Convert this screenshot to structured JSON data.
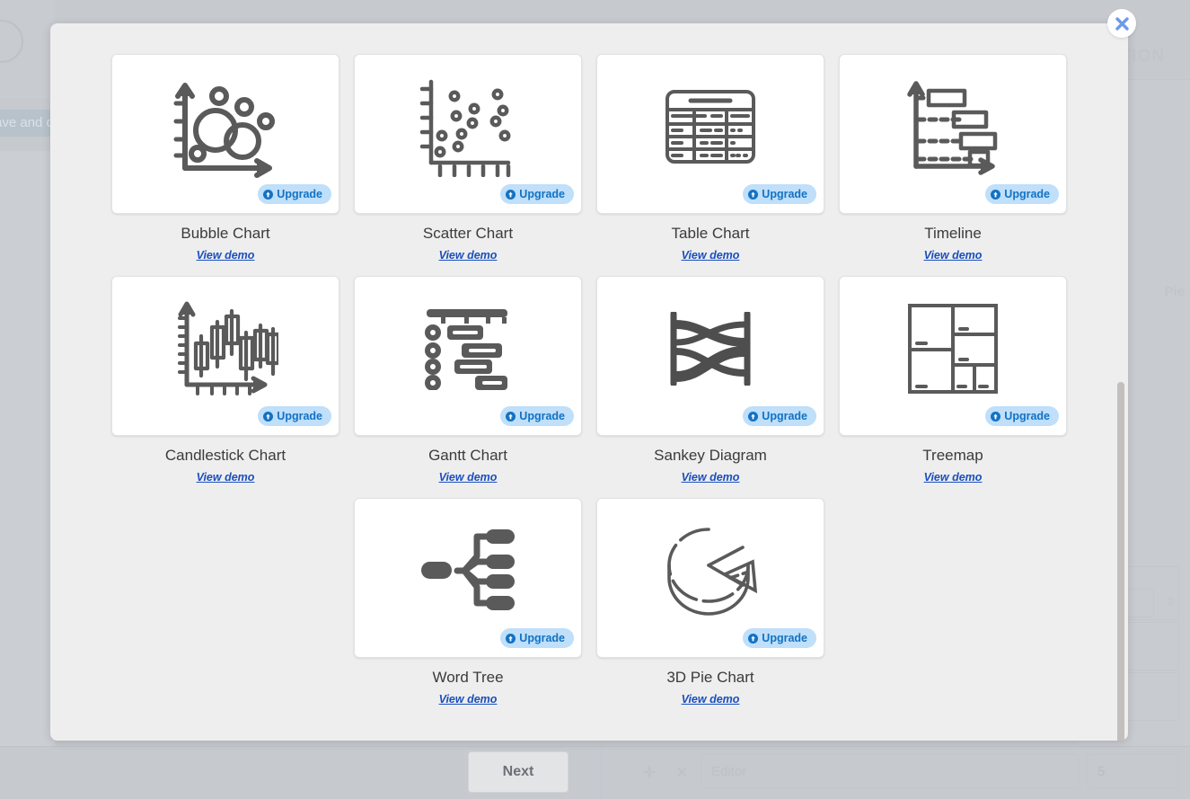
{
  "modal": {
    "close_label": "×",
    "scrollbar_name": "vertical-scrollbar"
  },
  "background": {
    "save_and_close_label": "ave and c",
    "question_label": "STION",
    "pie_label": "Pie",
    "next_label": "Next",
    "editor_placeholder": "Editor",
    "number_value": "5",
    "close_glyph": "✕",
    "move_glyph": "✛"
  },
  "upgrade_badge": {
    "label": "Upgrade"
  },
  "common": {
    "view_demo_label": "View demo"
  },
  "cards": [
    {
      "id": "bubble-chart",
      "title": "Bubble Chart",
      "icon": "bubble-chart-icon",
      "badge": "Upgrade",
      "demo": "View demo"
    },
    {
      "id": "scatter-chart",
      "title": "Scatter Chart",
      "icon": "scatter-chart-icon",
      "badge": "Upgrade",
      "demo": "View demo"
    },
    {
      "id": "table-chart",
      "title": "Table Chart",
      "icon": "table-chart-icon",
      "badge": "Upgrade",
      "demo": "View demo"
    },
    {
      "id": "timeline",
      "title": "Timeline",
      "icon": "timeline-icon",
      "badge": "Upgrade",
      "demo": "View demo"
    },
    {
      "id": "candlestick-chart",
      "title": "Candlestick Chart",
      "icon": "candlestick-chart-icon",
      "badge": "Upgrade",
      "demo": "View demo"
    },
    {
      "id": "gantt-chart",
      "title": "Gantt Chart",
      "icon": "gantt-chart-icon",
      "badge": "Upgrade",
      "demo": "View demo"
    },
    {
      "id": "sankey-diagram",
      "title": "Sankey Diagram",
      "icon": "sankey-diagram-icon",
      "badge": "Upgrade",
      "demo": "View demo"
    },
    {
      "id": "treemap",
      "title": "Treemap",
      "icon": "treemap-icon",
      "badge": "Upgrade",
      "demo": "View demo"
    },
    {
      "id": "word-tree",
      "title": "Word Tree",
      "icon": "word-tree-icon",
      "badge": "Upgrade",
      "demo": "View demo"
    },
    {
      "id": "3d-pie-chart",
      "title": "3D Pie Chart",
      "icon": "pie-3d-chart-icon",
      "badge": "Upgrade",
      "demo": "View demo"
    }
  ],
  "colors": {
    "modal_background": "#eeeeee",
    "card_background": "#ffffff",
    "icon_stroke": "#5a5a5a",
    "badge_background": "#bfdffa",
    "badge_text": "#1272c4",
    "title_text": "#3b3b3b",
    "link_text": "#1a4fbd",
    "overlay": "#c6c9ce"
  }
}
